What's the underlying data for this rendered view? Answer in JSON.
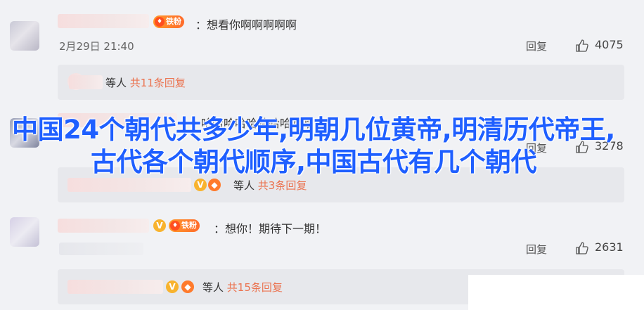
{
  "comments": [
    {
      "text": "：想看你啊啊啊啊啊",
      "fan_label": "铁粉",
      "time": "2月29日 21:40",
      "reply_label": "回复",
      "likes": "4075",
      "sub_waiting": "等人",
      "sub_total": "共11条回复"
    },
    {
      "text": "：哈哈哈哈哈哈哈哈哈哈",
      "reply_label": "回复",
      "likes": "3278",
      "sub_waiting": "等人",
      "sub_total": "共3条回复"
    },
    {
      "text": "：想你！期待下一期！",
      "fan_label": "铁粉",
      "reply_label": "回复",
      "likes": "2631",
      "sub_waiting": "等人",
      "sub_total": "共15条回复"
    }
  ],
  "overlay_title": "中国24个朝代共多少年,明朝几位黄帝,明清历代帝王,古代各个朝代顺序,中国古代有几个朝代",
  "colors": {
    "title_blue": "#1f5fff",
    "reply_count": "#eb7350",
    "vip_badge": "#f8b32e",
    "fan_badge": "#ff6b2b"
  }
}
